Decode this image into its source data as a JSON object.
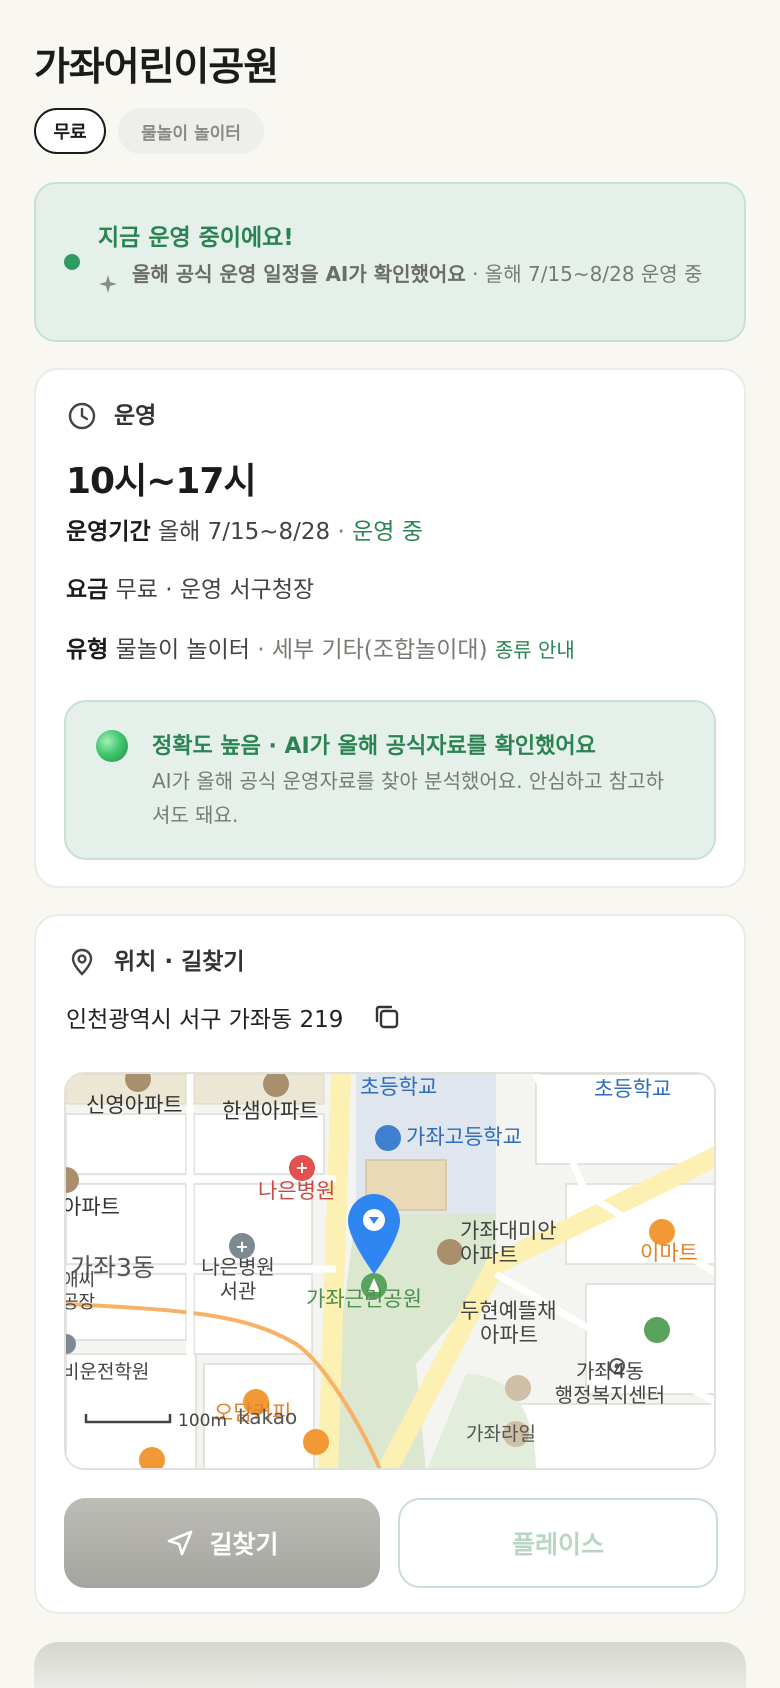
{
  "page": {
    "title": "가좌어린이공원"
  },
  "chips": {
    "fee": "무료",
    "type": "물놀이 놀이터"
  },
  "status": {
    "title": "지금 운영 중이에요!",
    "desc_strong": "올해 공식 운영 일정을 AI가 확인했어요",
    "desc_rest": " · 올해 7/15~8/28 운영 중"
  },
  "operation": {
    "section_label": "운영",
    "hours": "10시~17시",
    "period_label": "운영기간",
    "period_value": "올해 7/15~8/28",
    "period_sep": " · ",
    "period_status": "운영 중",
    "fee_label": "요금",
    "fee_value": "무료 · 운영 서구청장",
    "type_label": "유형",
    "type_value": "물놀이 놀이터",
    "type_detail": " · 세부 기타(조합놀이대)",
    "type_link": "종류 안내",
    "accuracy_title": "정확도 높음 · AI가 올해 공식자료를 확인했어요",
    "accuracy_desc": "AI가 올해 공식 운영자료를 찾아 분석했어요. 안심하고 참고하셔도 돼요."
  },
  "location": {
    "section_label": "위치 · 길찾기",
    "address": "인천광역시 서구 가좌동 219",
    "route_button": "길찾기",
    "place_button": "플레이스",
    "map_labels": {
      "sinyoung": "신영아파트",
      "hansaem": "한샘아파트",
      "school1": "초등학교",
      "school2": "초등학교",
      "gajwa_high": "가좌고등학교",
      "naeun": "나은병원",
      "apart_left": "아파트",
      "naeun_annex_1": "나은병원",
      "naeun_annex_2": "서관",
      "gajwa3": "가좌3동",
      "ssi": "애씨",
      "factory": "공장",
      "park": "가좌근린공원",
      "daemian_1": "가좌대미안",
      "daemian_2": "아파트",
      "emart": "이마트",
      "duhyeon_1": "두현예뜰채",
      "duhyeon_2": "아파트",
      "gajwa4_1": "가좌4동",
      "gajwa4_2": "행정복지센터",
      "driving": "비운전학원",
      "cafe": "오담커피",
      "gajwa_line": "가좌라일",
      "scale": "100m",
      "brand": "kakao"
    }
  }
}
